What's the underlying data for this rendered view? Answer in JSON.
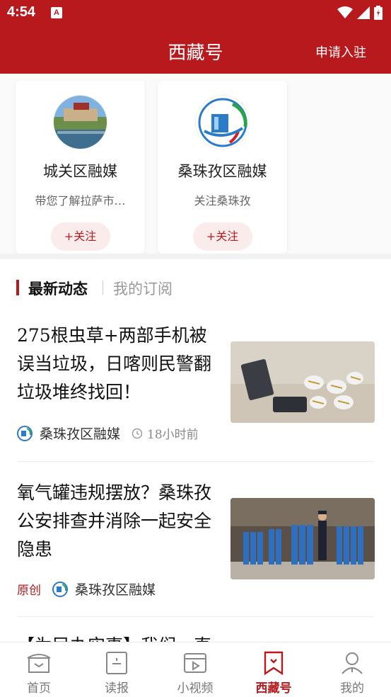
{
  "status": {
    "time": "4:54",
    "notification_badge": "A",
    "icons": [
      "wifi-icon",
      "signal-icon",
      "battery-icon"
    ]
  },
  "header": {
    "title": "西藏号",
    "action_label": "申请入驻"
  },
  "colors": {
    "brand": "#b8191d",
    "follow_bg": "#fbecec",
    "muted": "#999999"
  },
  "accounts": [
    {
      "name": "城关区融媒",
      "desc": "带您了解拉萨市…",
      "follow_label": "+关注"
    },
    {
      "name": "桑珠孜区融媒",
      "desc": "关注桑珠孜",
      "follow_label": "+关注"
    }
  ],
  "tabs": {
    "active": "最新动态",
    "other": "我的订阅"
  },
  "articles": [
    {
      "title": "275根虫草+两部手机被误当垃圾，日喀则民警翻垃圾堆终找回！",
      "source": "桑珠孜区融媒",
      "time": "18小时前"
    },
    {
      "title": "氧气罐违规摆放？桑珠孜公安排查并消除一起安全隐患",
      "tag": "原创",
      "source": "桑珠孜区融媒"
    },
    {
      "title": "【为民办实事】我们一直"
    }
  ],
  "nav": [
    {
      "label": "首页",
      "icon": "home-icon"
    },
    {
      "label": "读报",
      "icon": "newspaper-icon"
    },
    {
      "label": "小视频",
      "icon": "video-icon"
    },
    {
      "label": "西藏号",
      "icon": "bookmark-icon",
      "active": true
    },
    {
      "label": "我的",
      "icon": "user-icon"
    }
  ]
}
